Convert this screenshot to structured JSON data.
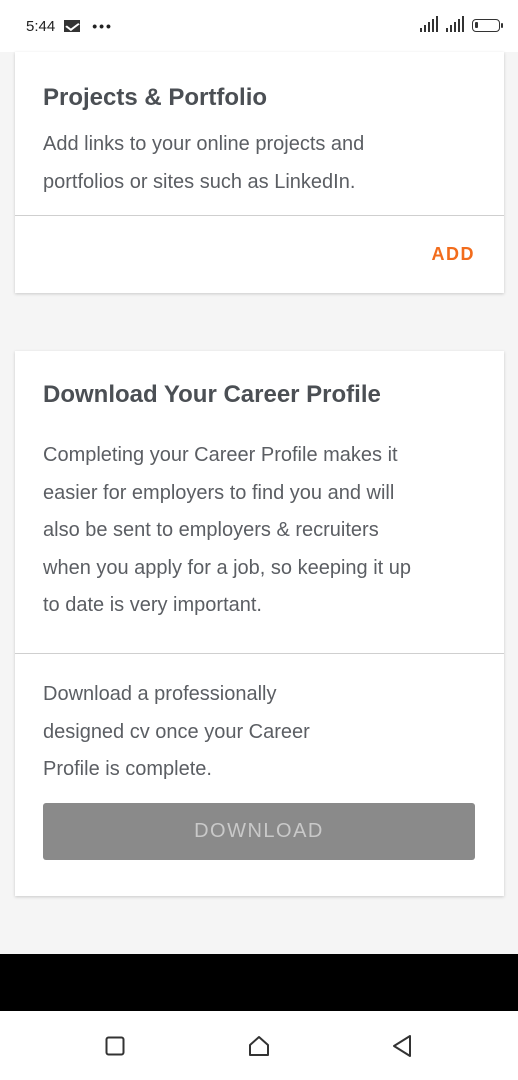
{
  "status_bar": {
    "time": "5:44",
    "dots": "•••",
    "icons": [
      "mail-icon",
      "signal-icon",
      "battery-icon"
    ]
  },
  "projects_card": {
    "title": "Projects & Portfolio",
    "description_line1": "Add links to your online projects and",
    "description_line2": "portfolios or sites such as LinkedIn.",
    "add_label": "ADD"
  },
  "career_card": {
    "title": "Download Your Career Profile",
    "description_lines": [
      "Completing your Career Profile makes it",
      "easier for employers to find you and will",
      "also be sent to employers & recruiters",
      "when you apply for a job, so keeping it up",
      "to date is very important."
    ],
    "cv_lines": [
      "Download a professionally",
      "designed cv once your Career",
      "Profile is complete."
    ],
    "download_label": "DOWNLOAD"
  },
  "nav_bar": {
    "icons": [
      "recent-apps-icon",
      "home-icon",
      "back-icon"
    ]
  },
  "colors": {
    "accent": "#f26c1c",
    "button_disabled": "#8a8a8a",
    "background": "#f5f5f5"
  }
}
